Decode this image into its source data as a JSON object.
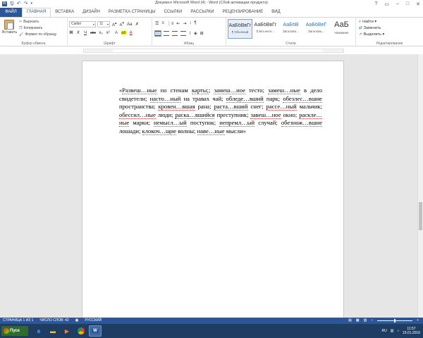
{
  "window": {
    "title": "Документ Microsoft Word (4) - Word (Сбой активации продукта)"
  },
  "qat": {
    "save_icon": "save-icon",
    "undo_icon": "undo-icon",
    "redo_icon": "redo-icon"
  },
  "tabs": [
    {
      "label": "ФАЙЛ"
    },
    {
      "label": "ГЛАВНАЯ"
    },
    {
      "label": "ВСТАВКА"
    },
    {
      "label": "ДИЗАЙН"
    },
    {
      "label": "РАЗМЕТКА СТРАНИЦЫ"
    },
    {
      "label": "ССЫЛКИ"
    },
    {
      "label": "РАССЫЛКИ"
    },
    {
      "label": "РЕЦЕНЗИРОВАНИЕ"
    },
    {
      "label": "ВИД"
    }
  ],
  "clipboard": {
    "paste": "Вставить",
    "cut": "Вырезать",
    "copy": "Копировать",
    "format_painter": "Формат по образцу",
    "group": "Буфер обмена"
  },
  "font": {
    "name": "Calibri",
    "size": "11",
    "group": "Шрифт",
    "bold": "Ж",
    "italic": "К",
    "underline": "Ч",
    "strike": "abc",
    "sub": "x₂",
    "sup": "x²"
  },
  "paragraph": {
    "group": "Абзац"
  },
  "styles": {
    "group": "Стили",
    "items": [
      {
        "preview": "АаБбВвГг",
        "name": "¶ Обычный"
      },
      {
        "preview": "АаБбВвГг",
        "name": "¶ Без инте..."
      },
      {
        "preview": "АаБбВ",
        "name": "Заголово..."
      },
      {
        "preview": "АаБбВеГ",
        "name": "Заголово..."
      },
      {
        "preview": "АаБ",
        "name": "Название"
      }
    ]
  },
  "editing": {
    "find": "Найти",
    "replace": "Заменить",
    "select": "Выделить",
    "group": "Редактирование"
  },
  "document": {
    "segments": [
      {
        "text": "«"
      },
      {
        "text": "Развеш…ные",
        "mark": true
      },
      {
        "text": " по стенам "
      },
      {
        "text": "карты;",
        "mark": true
      },
      {
        "text": "; "
      },
      {
        "text": "замеш…ное",
        "mark": true
      },
      {
        "text": " тесто; "
      },
      {
        "text": "замеш…ные",
        "mark": true
      },
      {
        "text": " в дело свидетели; "
      },
      {
        "text": "насто…ный",
        "mark": true
      },
      {
        "text": " на травах чай; "
      },
      {
        "text": "обледе…вший",
        "mark": true
      },
      {
        "text": " парк; "
      },
      {
        "text": "обезлес…вшие",
        "mark": true
      },
      {
        "text": " пространства; "
      },
      {
        "text": "кровен…вшая",
        "mark": true
      },
      {
        "text": " рана; "
      },
      {
        "text": "раста…вший",
        "mark": true
      },
      {
        "text": " снег; "
      },
      {
        "text": "рассе…ный",
        "mark": true
      },
      {
        "text": " мальчик; "
      },
      {
        "text": "обессил…ные",
        "mark": true
      },
      {
        "text": " люди; "
      },
      {
        "text": "раска…вшийся",
        "mark": true
      },
      {
        "text": " преступник; "
      },
      {
        "text": "завеш…ное",
        "mark": true
      },
      {
        "text": " окно; "
      },
      {
        "text": "раскле…ные",
        "mark": true
      },
      {
        "text": " марки; "
      },
      {
        "text": "немысл…ый",
        "mark": true
      },
      {
        "text": " поступок; "
      },
      {
        "text": "непремл…ый",
        "mark": true
      },
      {
        "text": " случай; "
      },
      {
        "text": "обезнож…вшие",
        "mark": true
      },
      {
        "text": " лошади; "
      },
      {
        "text": "клокоч…щие",
        "mark": true
      },
      {
        "text": " волны; "
      },
      {
        "text": "наве…ные",
        "mark": true
      },
      {
        "text": " мысли»"
      }
    ]
  },
  "status": {
    "page": "СТРАНИЦА 1 ИЗ 1",
    "words": "ЧИСЛО СЛОВ: 42",
    "lang": "РУССКИЙ",
    "zoom_fraction": 0.5
  },
  "taskbar": {
    "start": "Пуск",
    "lang": "RU",
    "time": "11:57",
    "date": "19.01.2016"
  }
}
